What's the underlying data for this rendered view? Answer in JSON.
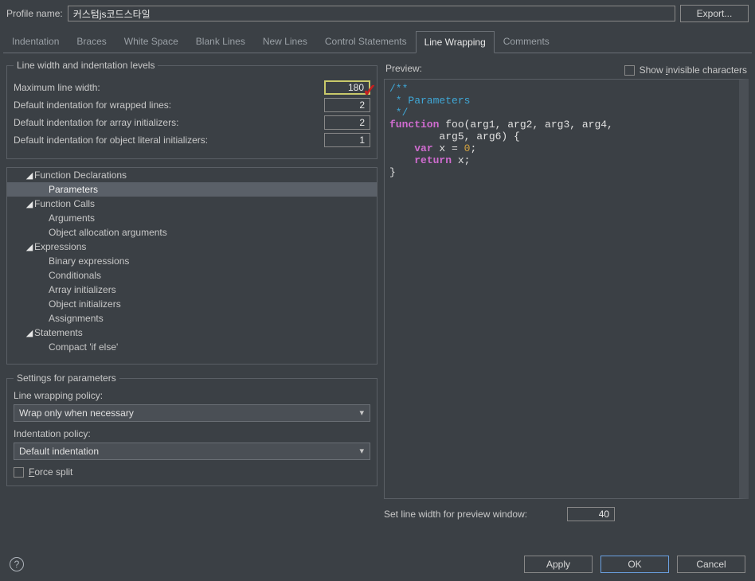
{
  "profile": {
    "name_label": "Profile name:",
    "name_value": "커스텀js코드스타일",
    "export_label": "Export..."
  },
  "tabs": [
    "Indentation",
    "Braces",
    "White Space",
    "Blank Lines",
    "New Lines",
    "Control Statements",
    "Line Wrapping",
    "Comments"
  ],
  "active_tab_index": 6,
  "linewidth_group": {
    "legend": "Line width and indentation levels",
    "rows": [
      {
        "label": "Maximum line width:",
        "value": "180",
        "highlight": true
      },
      {
        "label": "Default indentation for wrapped lines:",
        "value": "2"
      },
      {
        "label": "Default indentation for array initializers:",
        "value": "2"
      },
      {
        "label": "Default indentation for object literal initializers:",
        "value": "1"
      }
    ]
  },
  "tree": [
    {
      "label": "Function Declarations",
      "level": 1,
      "arrow": true
    },
    {
      "label": "Parameters",
      "level": 2,
      "selected": true
    },
    {
      "label": "Function Calls",
      "level": 1,
      "arrow": true
    },
    {
      "label": "Arguments",
      "level": 2
    },
    {
      "label": "Object allocation arguments",
      "level": 2
    },
    {
      "label": "Expressions",
      "level": 1,
      "arrow": true
    },
    {
      "label": "Binary expressions",
      "level": 2
    },
    {
      "label": "Conditionals",
      "level": 2
    },
    {
      "label": "Array initializers",
      "level": 2
    },
    {
      "label": "Object initializers",
      "level": 2
    },
    {
      "label": "Assignments",
      "level": 2
    },
    {
      "label": "Statements",
      "level": 1,
      "arrow": true
    },
    {
      "label": "Compact 'if else'",
      "level": 2
    }
  ],
  "settings_group": {
    "legend": "Settings for parameters",
    "line_wrap_label": "Line wrapping policy:",
    "line_wrap_value": "Wrap only when necessary",
    "indent_label": "Indentation policy:",
    "indent_value": "Default indentation",
    "force_split_label_pre": "F",
    "force_split_label_post": "orce split"
  },
  "preview": {
    "title": "Preview:",
    "show_invis_pre": "Show ",
    "show_invis_mn": "i",
    "show_invis_post": "nvisible characters",
    "code": {
      "l1": "/**",
      "l2": " * Parameters",
      "l3": " */",
      "l4a": "function",
      "l4b": " foo(arg1, arg2, arg3, arg4,",
      "l5": "        arg5, arg6) {",
      "l6a": "    ",
      "l6b": "var",
      "l6c": " x = ",
      "l6d": "0",
      "l6e": ";",
      "l7a": "    ",
      "l7b": "return",
      "l7c": " x;",
      "l8": "}"
    },
    "set_width_label": "Set line width for preview window:",
    "set_width_value": "40"
  },
  "buttons": {
    "apply": "Apply",
    "ok": "OK",
    "cancel": "Cancel"
  }
}
